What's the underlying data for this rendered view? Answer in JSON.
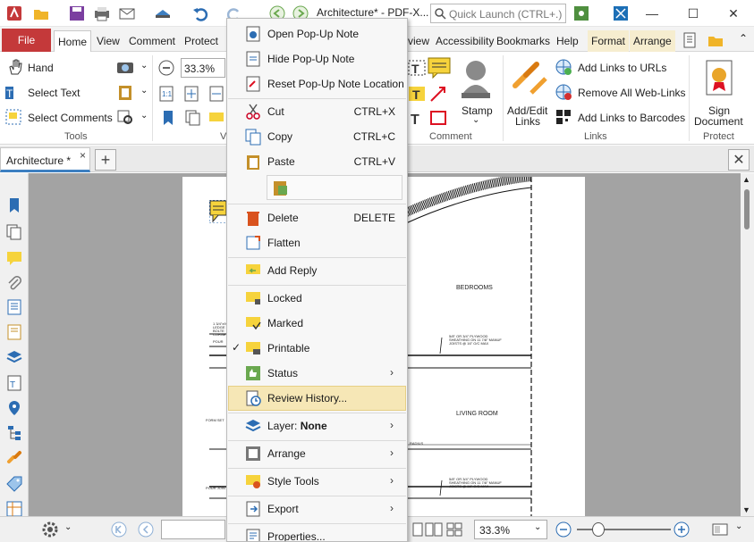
{
  "window": {
    "title": "Architecture* - PDF-X...",
    "quick_launch_placeholder": "Quick Launch (CTRL+.)",
    "minimize": "—",
    "maximize": "☐",
    "close": "✕"
  },
  "ribbon_tabs": {
    "file": "File",
    "home": "Home",
    "view": "View",
    "comment": "Comment",
    "protect": "Protect",
    "review_partial": "view",
    "accessibility": "Accessibility",
    "bookmarks": "Bookmarks",
    "help": "Help",
    "format": "Format",
    "arrange": "Arrange"
  },
  "ribbon": {
    "hand": "Hand",
    "select_text": "Select Text",
    "select_comments": "Select Comments",
    "tools_group": "Tools",
    "zoom_value": "33.3%",
    "view_group_partial": "V",
    "stamp": "Stamp",
    "comment_group": "Comment",
    "add_edit_links_1": "Add/Edit",
    "add_edit_links_2": "Links",
    "add_links_urls": "Add Links to URLs",
    "remove_web_links": "Remove All Web-Links",
    "add_links_barcodes": "Add Links to Barcodes",
    "links_group": "Links",
    "sign_document_1": "Sign",
    "sign_document_2": "Document",
    "protect_group": "Protect"
  },
  "doc_tabs": {
    "active": "Architecture *",
    "close_x": "×",
    "add": "+",
    "close_all": "✕"
  },
  "plan": {
    "bedrooms": "BEDROOMS",
    "living_room": "LIVING ROOM",
    "note1_l1": "5/8\" OR 3/4\" PLYWOOD",
    "note1_l2": "SHEATHING ON 11 7/8\" MANUF",
    "note1_l3": "JOISTS @ 16\" O/C MAX",
    "note2_l1": "5/8\" OR 3/4\" PLYWOOD",
    "note2_l2": "SHEATHING ON 11 7/8\" MANUF",
    "note2_l3": "JOISTS @ 16\" O/C MAX",
    "left1": "1 3/4\"x9",
    "left2": "LEDGE",
    "left3": "BOLTE",
    "left4": "CORNE",
    "left5": "POUR",
    "left6": "FORM SET",
    "left7": "POUR JOIN",
    "radius": "RADIUS"
  },
  "context_menu": {
    "open_popup": "Open Pop-Up Note",
    "hide_popup": "Hide Pop-Up Note",
    "reset_popup": "Reset Pop-Up Note Location",
    "cut": "Cut",
    "cut_sc": "CTRL+X",
    "copy": "Copy",
    "copy_sc": "CTRL+C",
    "paste": "Paste",
    "paste_sc": "CTRL+V",
    "delete": "Delete",
    "delete_sc": "DELETE",
    "flatten": "Flatten",
    "add_reply": "Add Reply",
    "locked": "Locked",
    "marked": "Marked",
    "printable": "Printable",
    "printable_check": "✓",
    "status": "Status",
    "review_history": "Review History...",
    "layer_prefix": "Layer: ",
    "layer_value": "None",
    "arrange": "Arrange",
    "style_tools": "Style Tools",
    "export": "Export",
    "properties": "Properties..."
  },
  "statusbar": {
    "zoom_value": "33.3%"
  },
  "colors": {
    "file_tab": "#c4393a",
    "highlight": "#f6e7b6",
    "accent_blue": "#3d7fc1",
    "note_yellow": "#f6d33c"
  }
}
